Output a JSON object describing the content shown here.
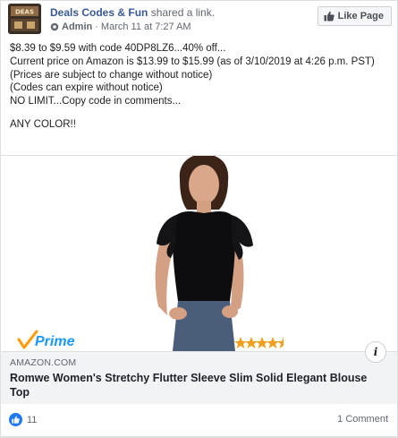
{
  "header": {
    "page_name": "Deals Codes & Fun",
    "action": " shared a link.",
    "role": "Admin",
    "separator": " · ",
    "timestamp": "March 11 at 7:27 AM",
    "like_page_label": "Like Page",
    "avatar_text": "DEAS"
  },
  "post": {
    "lines": [
      "$8.39 to $9.59 with code 40DP8LZ6...40% off...",
      "Current price on Amazon is $13.99 to $15.99 (as of 3/10/2019 at 4:26 p.m. PST)",
      "(Prices are subject to change without notice)",
      "(Codes can expire without notice)",
      "NO LIMIT...Copy code in comments...",
      "ANY COLOR!!"
    ]
  },
  "link": {
    "prime_label": "Prime",
    "domain": "AMAZON.COM",
    "title": "Romwe Women's Stretchy Flutter Sleeve Slim Solid Elegant Blouse Top",
    "rating_stars": 4.5,
    "info_glyph": "i"
  },
  "footer": {
    "likes_count": "11",
    "comments_label": "1 Comment"
  },
  "colors": {
    "name_blue": "#385898",
    "like_blue": "#2078f4",
    "caption_bg": "#f2f3f5",
    "prime_blue": "#1a98ff",
    "star_orange": "#f0a01e"
  }
}
